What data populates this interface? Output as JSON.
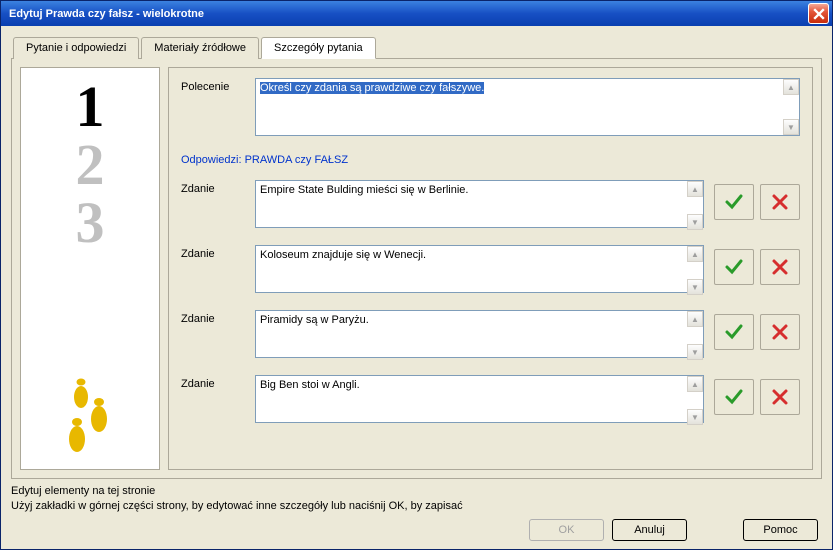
{
  "window": {
    "title": "Edytuj Prawda czy fałsz - wielokrotne"
  },
  "tabs": {
    "question": "Pytanie i odpowiedzi",
    "materials": "Materiały źródłowe",
    "details": "Szczegóły pytania"
  },
  "labels": {
    "instruction": "Polecenie",
    "answers_header": "Odpowiedzi: PRAWDA czy FAŁSZ",
    "sentence": "Zdanie"
  },
  "instruction_value": "Określ czy zdania są prawdziwe czy fałszywe.",
  "sentences": [
    "Empire State Bulding mieści się w Berlinie.",
    "Koloseum znajduje się w Wenecji.",
    "Piramidy są w Paryżu.",
    "Big Ben stoi w Angli."
  ],
  "help": {
    "line1": "Edytuj elementy na tej stronie",
    "line2": "Użyj zakładki w górnej części strony, by edytować inne szczegóły lub naciśnij OK, by zapisać"
  },
  "buttons": {
    "ok": "OK",
    "cancel": "Anuluj",
    "help": "Pomoc"
  }
}
